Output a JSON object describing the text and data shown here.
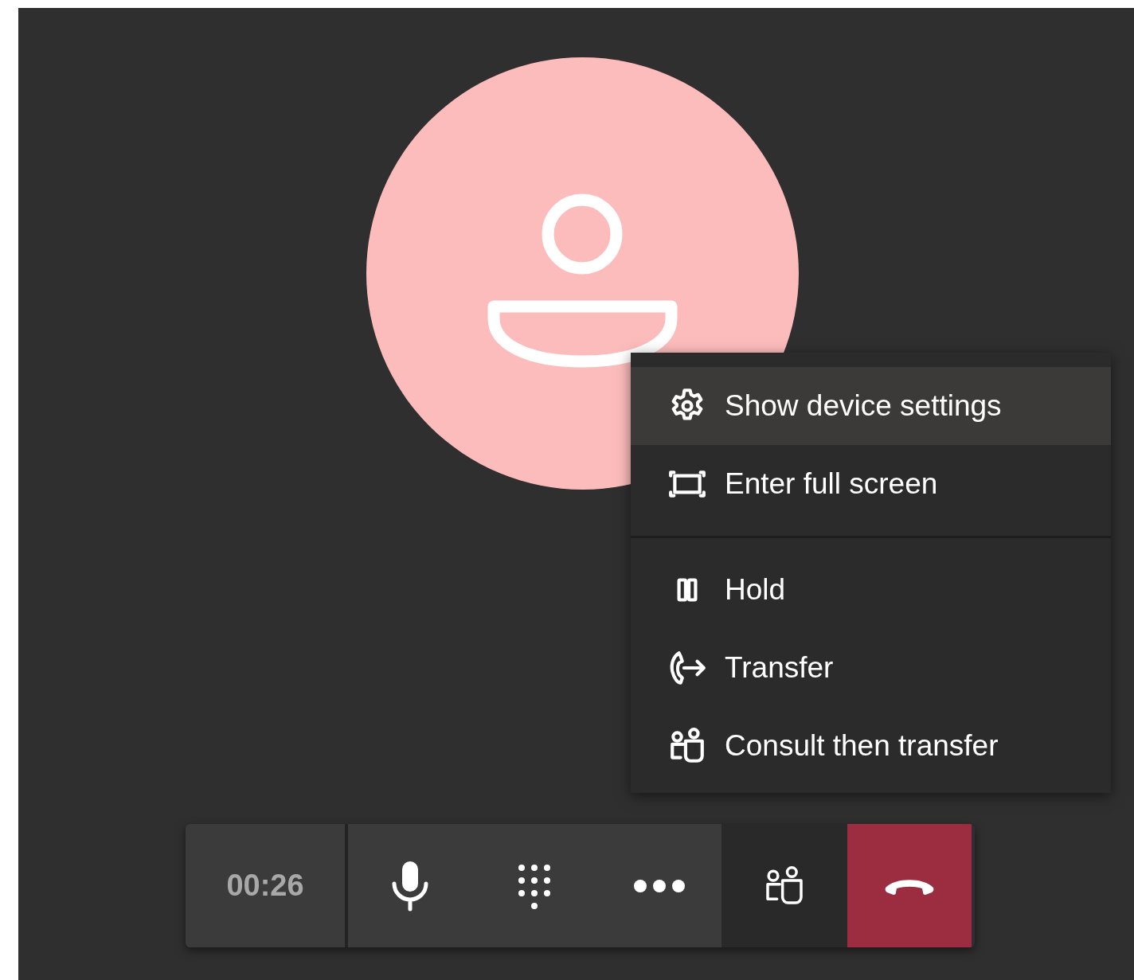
{
  "menu": {
    "groups": [
      {
        "items": [
          {
            "kind": "settings",
            "label": "Show device settings",
            "selected": true
          },
          {
            "kind": "fullscreen",
            "label": "Enter full screen",
            "selected": false
          }
        ]
      },
      {
        "items": [
          {
            "kind": "hold",
            "label": "Hold",
            "selected": false
          },
          {
            "kind": "transfer",
            "label": "Transfer",
            "selected": false
          },
          {
            "kind": "consult",
            "label": "Consult then transfer",
            "selected": false
          }
        ]
      }
    ]
  },
  "toolbar": {
    "timer": "00:26",
    "buttons": [
      {
        "kind": "mic"
      },
      {
        "kind": "dialpad"
      },
      {
        "kind": "more"
      },
      {
        "kind": "people"
      },
      {
        "kind": "hangup"
      }
    ]
  }
}
